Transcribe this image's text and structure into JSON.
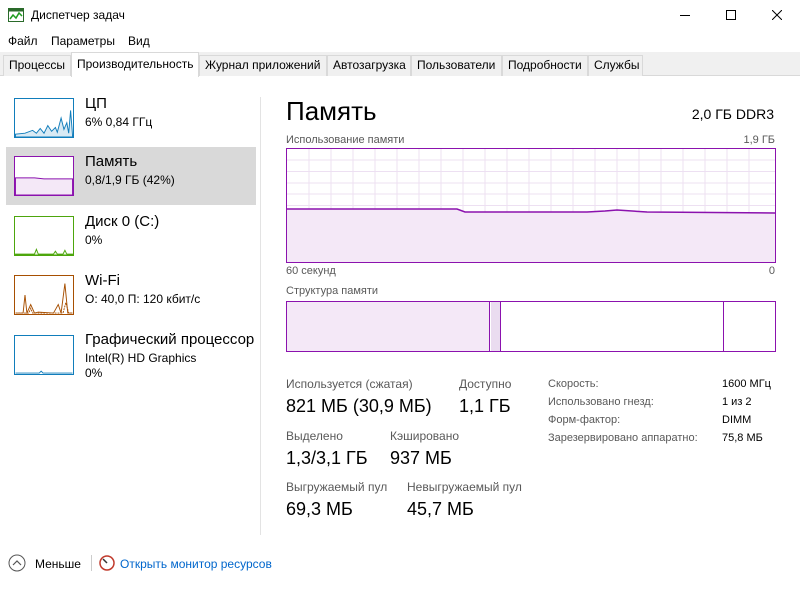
{
  "window": {
    "title": "Диспетчер задач"
  },
  "menu": [
    "Файл",
    "Параметры",
    "Вид"
  ],
  "tabs": [
    {
      "label": "Процессы"
    },
    {
      "label": "Производительность"
    },
    {
      "label": "Журнал приложений"
    },
    {
      "label": "Автозагрузка"
    },
    {
      "label": "Пользователи"
    },
    {
      "label": "Подробности"
    },
    {
      "label": "Службы"
    }
  ],
  "active_tab_index": 1,
  "resources": [
    {
      "name": "ЦП",
      "line1": "6% 0,84 ГГц",
      "line2": "",
      "color": "#117dbb"
    },
    {
      "name": "Память",
      "line1": "0,8/1,9 ГБ (42%)",
      "line2": "",
      "color": "#8b12ae"
    },
    {
      "name": "Диск 0 (C:)",
      "line1": "0%",
      "line2": "",
      "color": "#4da60c"
    },
    {
      "name": "Wi-Fi",
      "line1": "О: 40,0  П: 120 кбит/с",
      "line2": "",
      "color": "#a74f01"
    },
    {
      "name": "Графический процессор",
      "line1": "Intel(R) HD Graphics",
      "line2": "0%",
      "color": "#117dbb"
    }
  ],
  "selected_resource_index": 1,
  "main": {
    "title": "Память",
    "spec": "2,0 ГБ DDR3",
    "graph_label": "Использование памяти",
    "graph_max": "1,9 ГБ",
    "graph_time": "60 секунд",
    "graph_min": "0",
    "struct_label": "Структура памяти",
    "accent_color": "#8b12ae"
  },
  "stats": {
    "in_use_label": "Используется (сжатая)",
    "in_use_value": "821 МБ (30,9 МБ)",
    "available_label": "Доступно",
    "available_value": "1,1 ГБ",
    "committed_label": "Выделено",
    "committed_value": "1,3/3,1 ГБ",
    "cached_label": "Кэшировано",
    "cached_value": "937 МБ",
    "paged_label": "Выгружаемый пул",
    "paged_value": "69,3 МБ",
    "nonpaged_label": "Невыгружаемый пул",
    "nonpaged_value": "45,7 МБ"
  },
  "specs": [
    {
      "key": "Скорость:",
      "value": "1600 МГц"
    },
    {
      "key": "Использовано гнезд:",
      "value": "1 из 2"
    },
    {
      "key": "Форм-фактор:",
      "value": "DIMM"
    },
    {
      "key": "Зарезервировано аппаратно:",
      "value": "75,8 МБ"
    }
  ],
  "footer": {
    "less_label": "Меньше",
    "monitor_label": "Открыть монитор ресурсов"
  },
  "icons": {
    "app": "task-manager-icon",
    "minimize": "minimize-icon",
    "maximize": "maximize-icon",
    "close": "close-icon",
    "less": "chevron-up-icon",
    "monitor": "resource-monitor-icon"
  }
}
